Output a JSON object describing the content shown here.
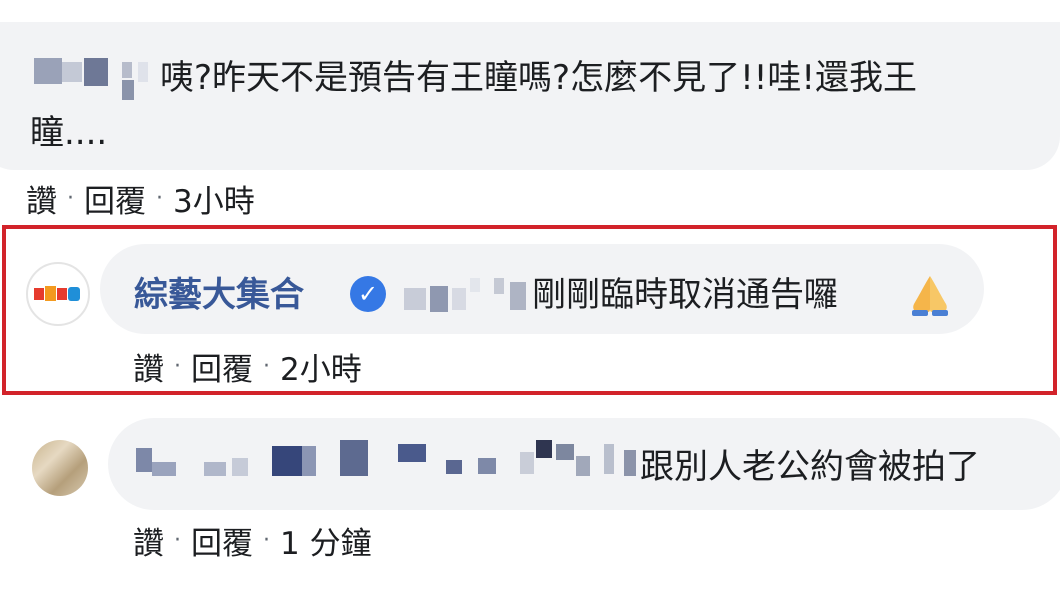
{
  "comments": [
    {
      "text_line1": "咦?昨天不是預告有王瞳嗎?怎麼不見了!!哇!還我王",
      "text_line2": "瞳....",
      "actions": {
        "like": "讚",
        "reply": "回覆",
        "time": "3小時"
      }
    },
    {
      "author": "綜藝大集合",
      "text": "剛剛臨時取消通告囉",
      "emoji": "folded-hands",
      "actions": {
        "like": "讚",
        "reply": "回覆",
        "time": "2小時"
      },
      "highlighted": true
    },
    {
      "text": "跟別人老公約會被拍了",
      "actions": {
        "like": "讚",
        "reply": "回覆",
        "time": "1 分鐘"
      }
    }
  ],
  "separator": "·",
  "colors": {
    "author": "#385898",
    "bubble": "#f2f3f5",
    "highlight": "#d2232a",
    "verified": "#3578e5"
  }
}
